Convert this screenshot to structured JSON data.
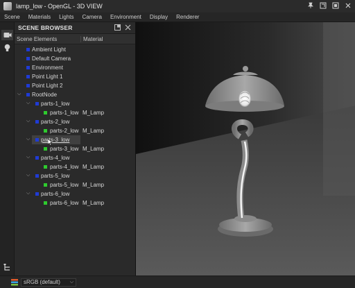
{
  "window": {
    "title": "lamp_low - OpenGL - 3D VIEW"
  },
  "menu": [
    "Scene",
    "Materials",
    "Lights",
    "Camera",
    "Environment",
    "Display",
    "Renderer"
  ],
  "scene_browser": {
    "title": "SCENE BROWSER",
    "columns": {
      "elements": "Scene Elements",
      "material": "Material"
    },
    "items": [
      {
        "label": "Ambient Light",
        "material": ""
      },
      {
        "label": "Default Camera",
        "material": ""
      },
      {
        "label": "Environment",
        "material": ""
      },
      {
        "label": "Point Light 1",
        "material": ""
      },
      {
        "label": "Point Light 2",
        "material": ""
      },
      {
        "label": "RootNode",
        "material": ""
      },
      {
        "label": "parts-1_low",
        "material": ""
      },
      {
        "label": "parts-1_low",
        "material": "M_Lamp"
      },
      {
        "label": "parts-2_low",
        "material": ""
      },
      {
        "label": "parts-2_low",
        "material": "M_Lamp"
      },
      {
        "label": "parts-3_low",
        "material": ""
      },
      {
        "label": "parts-3_low",
        "material": "M_Lamp"
      },
      {
        "label": "parts-4_low",
        "material": ""
      },
      {
        "label": "parts-4_low",
        "material": "M_Lamp"
      },
      {
        "label": "parts-5_low",
        "material": ""
      },
      {
        "label": "parts-5_low",
        "material": "M_Lamp"
      },
      {
        "label": "parts-6_low",
        "material": ""
      },
      {
        "label": "parts-6_low",
        "material": "M_Lamp"
      }
    ]
  },
  "status": {
    "color_space": "sRGB (default)"
  },
  "colors": {
    "object_marker": "#1f3bd6",
    "mesh_marker": "#2ecb2e"
  }
}
